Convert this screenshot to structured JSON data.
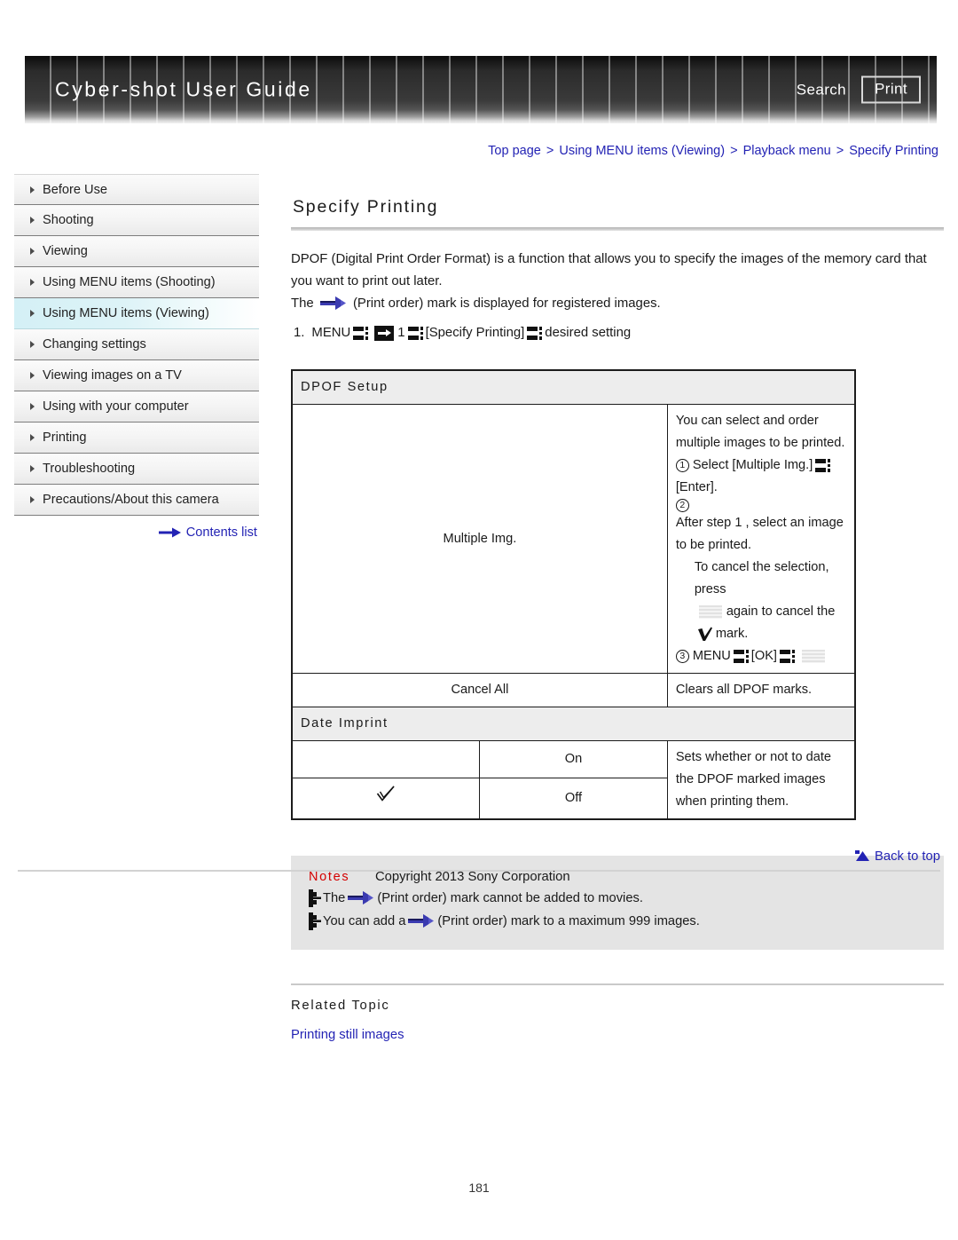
{
  "header": {
    "title": "Cyber-shot User Guide",
    "search_label": "Search",
    "print_label": "Print"
  },
  "breadcrumb": {
    "items": [
      "Top page",
      "Using MENU items (Viewing)",
      "Playback menu",
      "Specify Printing"
    ],
    "separator": ">"
  },
  "sidebar": {
    "items": [
      {
        "label": "Before Use",
        "active": false
      },
      {
        "label": "Shooting",
        "active": false
      },
      {
        "label": "Viewing",
        "active": false
      },
      {
        "label": "Using MENU items (Shooting)",
        "active": false
      },
      {
        "label": "Using MENU items (Viewing)",
        "active": true
      },
      {
        "label": "Changing settings",
        "active": false
      },
      {
        "label": "Viewing images on a TV",
        "active": false
      },
      {
        "label": "Using with your computer",
        "active": false
      },
      {
        "label": "Printing",
        "active": false
      },
      {
        "label": "Troubleshooting",
        "active": false
      },
      {
        "label": "Precautions/About this camera",
        "active": false
      }
    ],
    "contents_link": "Contents list"
  },
  "main": {
    "title": "Specify Printing",
    "intro_1": "DPOF (Digital Print Order Format) is a function that allows you to specify the images of the memory card that you want to print out later.",
    "intro_2_a": "The",
    "intro_2_b": "(Print order) mark is displayed for registered images.",
    "step": {
      "number": "1.",
      "menu": "MENU",
      "value": "1",
      "bracket_1": "[Specify Printing]",
      "tail": "desired setting"
    }
  },
  "table": {
    "section_1": "DPOF Setup",
    "multiple_img_label": "Multiple Img.",
    "multiple_img_intro": "You can select and order multiple images to be printed.",
    "step_1_num": "1",
    "step_1_a": "Select [Multiple Img.]",
    "step_1_b": "[Enter].",
    "step_2_num": "2",
    "step_2_text": "After step 1 , select an image to be printed.",
    "step_2_sub_a": "To cancel the selection, press",
    "step_2_sub_b": "again to cancel the",
    "step_2_sub_c": "mark.",
    "step_3_num": "3",
    "step_3_a": "MENU",
    "step_3_b": "[OK]",
    "cancel_all_label": "Cancel All",
    "cancel_all_desc": "Clears all DPOF marks.",
    "section_2": "Date Imprint",
    "on_label": "On",
    "off_label": "Off",
    "date_imprint_desc": "Sets whether or not to date the DPOF marked images when printing them."
  },
  "notes": {
    "title": "Notes",
    "note_1_a": "The",
    "note_1_b": "(Print order) mark cannot be added to movies.",
    "note_2_a": "You can add a",
    "note_2_b": "(Print order) mark to a maximum 999 images."
  },
  "related": {
    "title": "Related Topic",
    "link": "Printing still images"
  },
  "footer": {
    "back_to_top": "Back to top",
    "copyright": "Copyright 2013 Sony Corporation",
    "page_number": "181"
  },
  "colors": {
    "link": "#2323b4",
    "notes_title": "#d40000",
    "active_nav": "#d4f0f6",
    "print_order_mark": "#3a3ab0"
  }
}
